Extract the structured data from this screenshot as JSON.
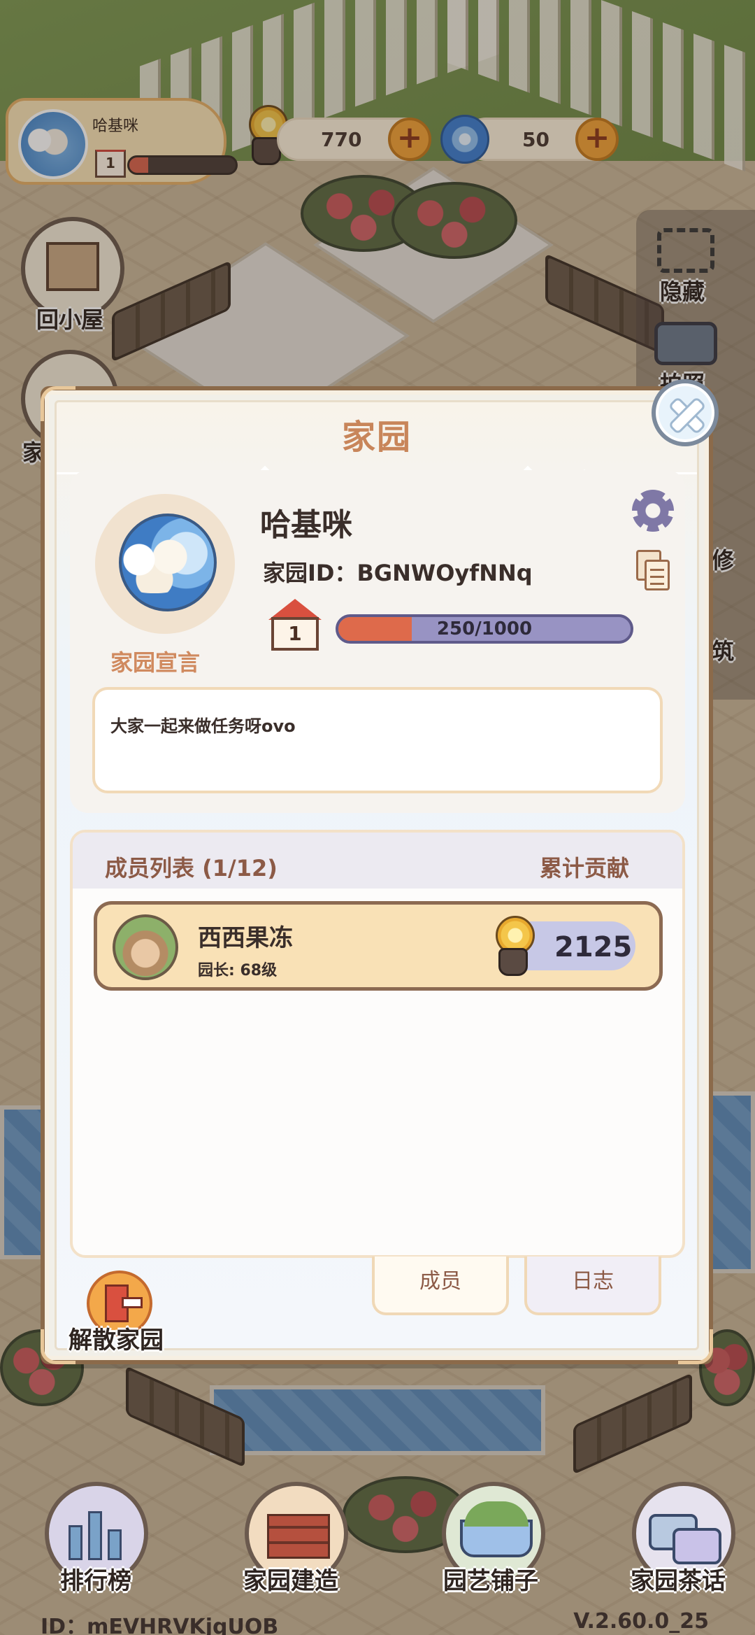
{
  "hud": {
    "player_name": "哈基咪",
    "player_level": "1",
    "player_exp_fraction": 0.18,
    "snail_coins": "770",
    "swirl_gems": "50"
  },
  "side": {
    "back_home": "回小屋",
    "right_hide": "隐藏",
    "right_photo": "拍照",
    "right_fix": "修",
    "right_build": "筑",
    "left_partial": "家"
  },
  "dialog": {
    "title": "家园",
    "home_name": "哈基咪",
    "home_id_label": "家园ID：",
    "home_id": "BGNWOyfNNq",
    "home_level": "1",
    "exp_text": "250/1000",
    "exp_fraction": 0.25,
    "motto_caption": "家园宣言",
    "motto_text": "大家一起来做任务呀ovo",
    "members_title": "成员列表 (1/12)",
    "contrib_title": "累计贡献",
    "members": [
      {
        "name": "西西果冻",
        "role": "园长: 68级",
        "score": "2125"
      }
    ],
    "tabs": {
      "members": "成员",
      "log": "日志"
    },
    "disband": "解散家园"
  },
  "nav": {
    "rank": "排行榜",
    "build": "家园建造",
    "shop": "园艺铺子",
    "chat": "家园茶话"
  },
  "footer": {
    "id_text": "ID：mEVHRVKjqUOB",
    "version": "V.2.60.0_25"
  },
  "colors": {
    "accent_title": "#c8855a",
    "exp_fill": "#de6a4b",
    "plus_button": "#f2a33a"
  }
}
